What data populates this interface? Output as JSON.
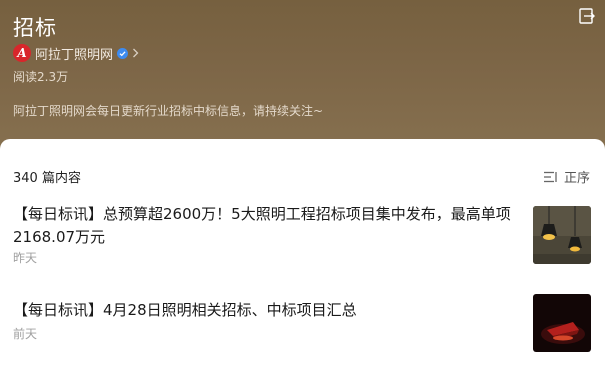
{
  "header": {
    "title": "招标",
    "author": "阿拉丁照明网",
    "author_logo_letter": "A",
    "reads": "阅读2.3万",
    "description": "阿拉丁照明网会每日更新行业招标中标信息，请持续关注~"
  },
  "list": {
    "count_label": "340 篇内容",
    "sort_label": "正序",
    "articles": [
      {
        "title": "【每日标讯】总预算超2600万！5大照明工程招标项目集中发布，最高单项2168.07万元",
        "time": "昨天",
        "thumb": "pendant-lamps-image"
      },
      {
        "title": "【每日标讯】4月28日照明相关招标、中标项目汇总",
        "time": "前天",
        "thumb": "red-lamp-dark-image"
      }
    ]
  },
  "colors": {
    "header_bg": "#7b6445",
    "brand_red": "#d8262b",
    "verified_blue": "#3d8bef"
  }
}
